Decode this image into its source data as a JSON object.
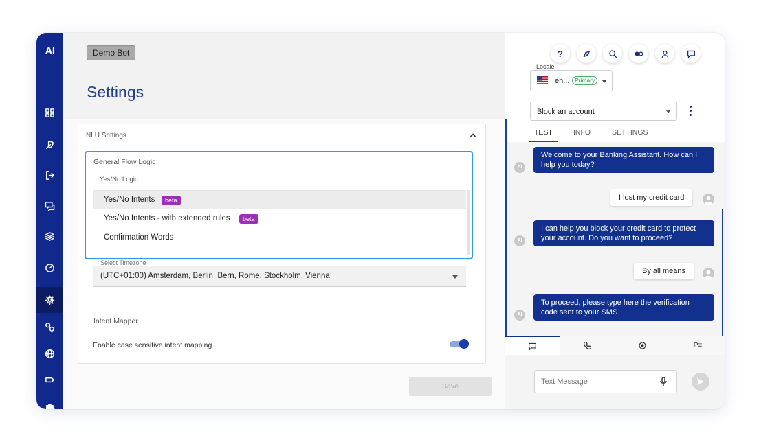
{
  "sidebar": {
    "logo": "AI",
    "items": [
      {
        "icon": "grid-icon"
      },
      {
        "icon": "rocket-icon"
      },
      {
        "icon": "logout-icon"
      },
      {
        "icon": "chat-bubbles-icon"
      },
      {
        "icon": "layers-icon"
      },
      {
        "icon": "gauge-icon"
      },
      {
        "icon": "gear-icon",
        "active": true
      },
      {
        "icon": "link-icon"
      },
      {
        "icon": "globe-icon"
      },
      {
        "icon": "tag-icon"
      },
      {
        "icon": "puzzle-icon"
      }
    ]
  },
  "header": {
    "bot_name": "Demo Bot",
    "page_title": "Settings"
  },
  "nlu": {
    "section_title": "NLU Settings",
    "timezone_label_peek": "Select Timezone",
    "timezone_value": "(UTC+01:00) Amsterdam, Berlin, Bern, Rome, Stockholm, Vienna",
    "intent_mapper_heading": "Intent Mapper",
    "case_sensitive_label": "Enable case sensitive intent mapping",
    "case_sensitive_enabled": true,
    "save_label": "Save"
  },
  "dropdown": {
    "label": "General Flow Logic",
    "group_label": "Yes/No Logic",
    "options": [
      {
        "label": "Yes/No Intents",
        "badge": "beta",
        "highlighted": true
      },
      {
        "label": "Yes/No Intents - with extended rules",
        "badge": "beta",
        "highlighted": false
      },
      {
        "label": "Confirmation Words",
        "badge": "",
        "highlighted": false
      }
    ]
  },
  "chat_panel": {
    "top_icons": [
      "help-icon",
      "compass-icon",
      "search-icon",
      "toggle-dots-icon",
      "user-icon",
      "message-icon"
    ],
    "help_glyph": "?",
    "locale": {
      "label": "Locale",
      "value": "en...",
      "primary_badge": "Primary"
    },
    "flow_select": "Block an account",
    "tabs": [
      "TEST",
      "INFO",
      "SETTINGS"
    ],
    "active_tab": "TEST",
    "avatar_label": "AI",
    "messages": [
      {
        "from": "bot",
        "text": "Welcome to your Banking Assistant. How can I help you today?"
      },
      {
        "from": "user",
        "text": "I lost my credit card"
      },
      {
        "from": "bot",
        "text": "I can help you block your credit card to protect your account. Do you want to proceed?"
      },
      {
        "from": "user",
        "text": "By all means"
      },
      {
        "from": "bot",
        "text": "To proceed, please type here the verification code sent to your SMS"
      }
    ],
    "bottom_tabs": [
      "chat-icon",
      "phone-icon",
      "record-icon",
      "pe-icon"
    ],
    "bottom_tab_pe": "P≡",
    "input_placeholder": "Text Message"
  },
  "colors": {
    "sidebar": "#11298c",
    "accent": "#12318f",
    "title": "#1f3f8a",
    "beta_badge": "#9b2fb5",
    "focus_ring": "#2f9ae8"
  }
}
